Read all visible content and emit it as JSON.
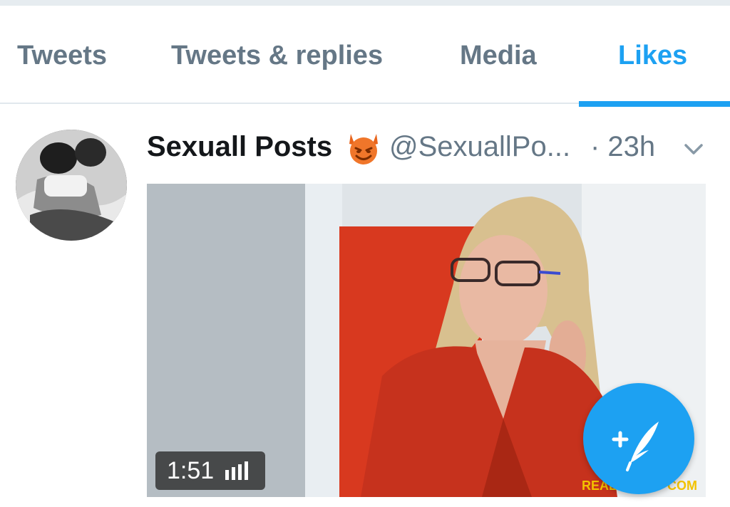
{
  "tabs": [
    {
      "label": "Tweets",
      "active": false
    },
    {
      "label": "Tweets & replies",
      "active": false
    },
    {
      "label": "Media",
      "active": false
    },
    {
      "label": "Likes",
      "active": true
    }
  ],
  "tweet": {
    "display_name": "Sexuall Posts",
    "emoji_icon": "smiling-devil-icon",
    "handle": "@SexuallPo...",
    "time": "· 23h",
    "media": {
      "type": "video",
      "duration": "1:51",
      "watermark_left": "REAL",
      "watermark_right": "COM"
    }
  },
  "colors": {
    "accent": "#1da1f2",
    "tab_inactive": "#657786",
    "text_primary": "#14171a"
  }
}
